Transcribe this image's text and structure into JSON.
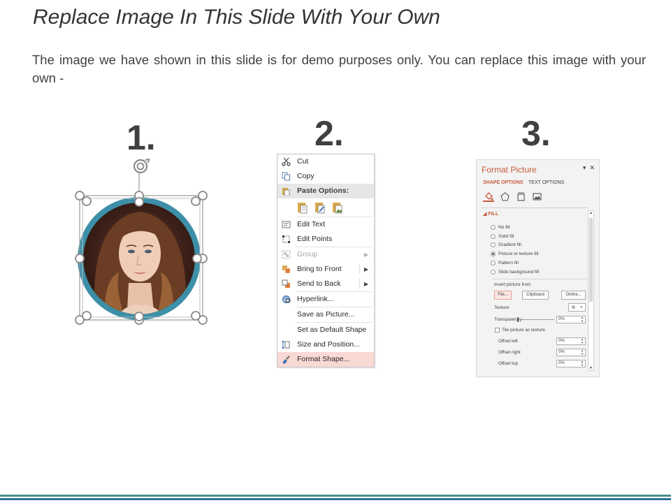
{
  "slide": {
    "title": "Replace Image In This Slide With Your Own",
    "body": "The image we have shown in this slide is for demo purposes only. You can replace this image with your own -"
  },
  "steps": [
    {
      "number": "1."
    },
    {
      "number": "2."
    },
    {
      "number": "3."
    }
  ],
  "context_menu": {
    "items": [
      {
        "label": "Cut",
        "icon": "scissors-icon"
      },
      {
        "label": "Copy",
        "icon": "copy-icon"
      },
      {
        "label": "Paste Options:",
        "icon": "paste-icon"
      },
      {
        "label": "Edit Text",
        "icon": "edit-text-icon"
      },
      {
        "label": "Edit Points",
        "icon": "edit-points-icon"
      },
      {
        "label": "Group",
        "icon": "group-icon"
      },
      {
        "label": "Bring to Front",
        "icon": "bring-to-front-icon"
      },
      {
        "label": "Send to Back",
        "icon": "send-to-back-icon"
      },
      {
        "label": "Hyperlink...",
        "icon": "hyperlink-icon"
      },
      {
        "label": "Save as Picture...",
        "icon": ""
      },
      {
        "label": "Set as Default Shape",
        "icon": ""
      },
      {
        "label": "Size and Position...",
        "icon": "size-position-icon"
      },
      {
        "label": "Format Shape...",
        "icon": "format-shape-icon"
      }
    ]
  },
  "format_pane": {
    "title": "Format Picture",
    "tabs": [
      "SHAPE OPTIONS",
      "TEXT OPTIONS"
    ],
    "section": "FILL",
    "fill_options": [
      "No fill",
      "Solid fill",
      "Gradient fill",
      "Picture or texture fill",
      "Pattern fill",
      "Slide background fill"
    ],
    "selected_fill": "Picture or texture fill",
    "insert_from_label": "Insert picture from",
    "buttons": {
      "file": "File...",
      "clipboard": "Clipboard",
      "online": "Online..."
    },
    "texture_label": "Texture",
    "transparency_label": "Transparency",
    "transparency_value": "0%",
    "tile_label": "Tile picture as texture",
    "offsets": [
      {
        "label": "Offset left",
        "value": "0%"
      },
      {
        "label": "Offset right",
        "value": "0%"
      },
      {
        "label": "Offset top",
        "value": "0%"
      }
    ]
  },
  "colors": {
    "accent": "#c55a3a",
    "ring": "#3d8fa8",
    "footer_top": "#4a8f93",
    "footer_bottom": "#2f6f9b"
  }
}
